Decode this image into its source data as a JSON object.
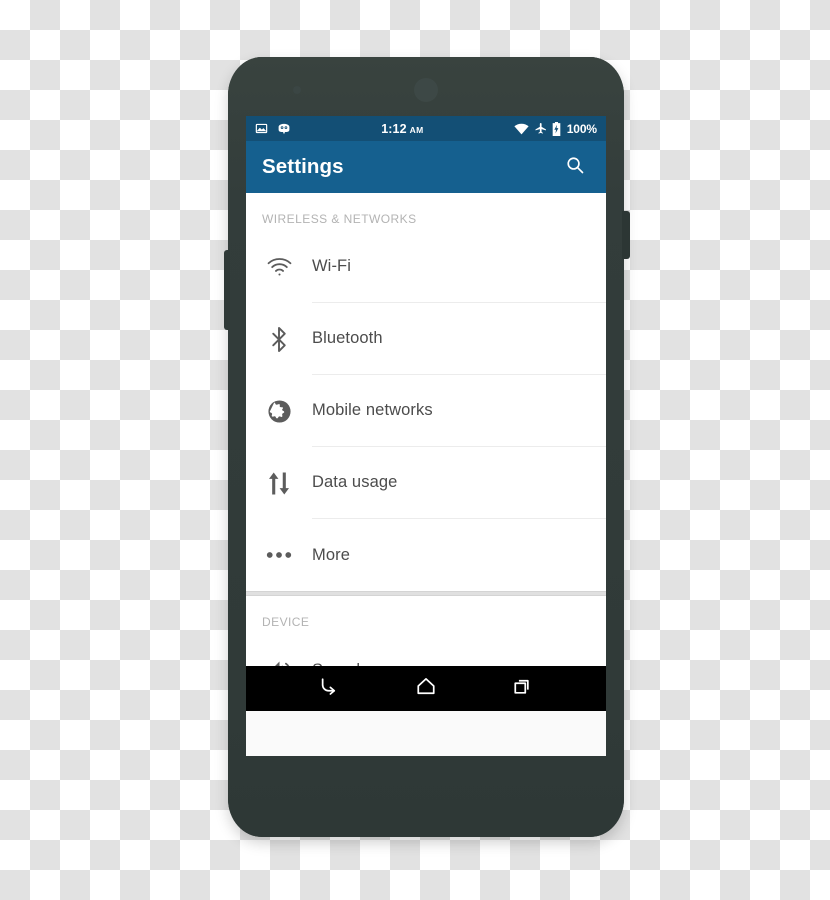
{
  "device": {
    "name": "android-smartphone-mockup",
    "bezel_color": "#333d3b",
    "screen_bg": "#ffffff"
  },
  "status_bar": {
    "background": "#134f75",
    "left_icons": [
      {
        "name": "photo-icon",
        "label": "Screenshot"
      },
      {
        "name": "cyanogenmod-robot-icon",
        "label": "CyanogenMod"
      }
    ],
    "clock": {
      "time": "1:12",
      "meridiem": "AM"
    },
    "right_icons": [
      {
        "name": "wifi-icon",
        "label": "Wi-Fi connected"
      },
      {
        "name": "airplane-mode-icon",
        "label": "Airplane mode"
      },
      {
        "name": "battery-charging-icon",
        "label": "Battery charging"
      }
    ],
    "battery_percent": "100%"
  },
  "app_bar": {
    "background": "#15608f",
    "title": "Settings",
    "search_icon": "search-icon"
  },
  "sections": [
    {
      "id": "wireless-networks",
      "header": "WIRELESS & NETWORKS",
      "items": [
        {
          "id": "wifi",
          "icon": "wifi-icon",
          "label": "Wi-Fi"
        },
        {
          "id": "bluetooth",
          "icon": "bluetooth-icon",
          "label": "Bluetooth"
        },
        {
          "id": "mobile-networks",
          "icon": "globe-icon",
          "label": "Mobile networks"
        },
        {
          "id": "data-usage",
          "icon": "data-transfer-icon",
          "label": "Data usage"
        },
        {
          "id": "more",
          "icon": "more-horizontal-icon",
          "label": "More"
        }
      ]
    },
    {
      "id": "device",
      "header": "DEVICE",
      "items": [
        {
          "id": "sounds",
          "icon": "volume-up-icon",
          "label": "Sounds"
        }
      ]
    }
  ],
  "nav_bar": {
    "background": "#000000",
    "buttons": [
      {
        "id": "back",
        "icon": "back-arrow-icon",
        "label": "Back"
      },
      {
        "id": "home",
        "icon": "home-icon",
        "label": "Home"
      },
      {
        "id": "recents",
        "icon": "recent-apps-icon",
        "label": "Recent apps"
      }
    ]
  }
}
